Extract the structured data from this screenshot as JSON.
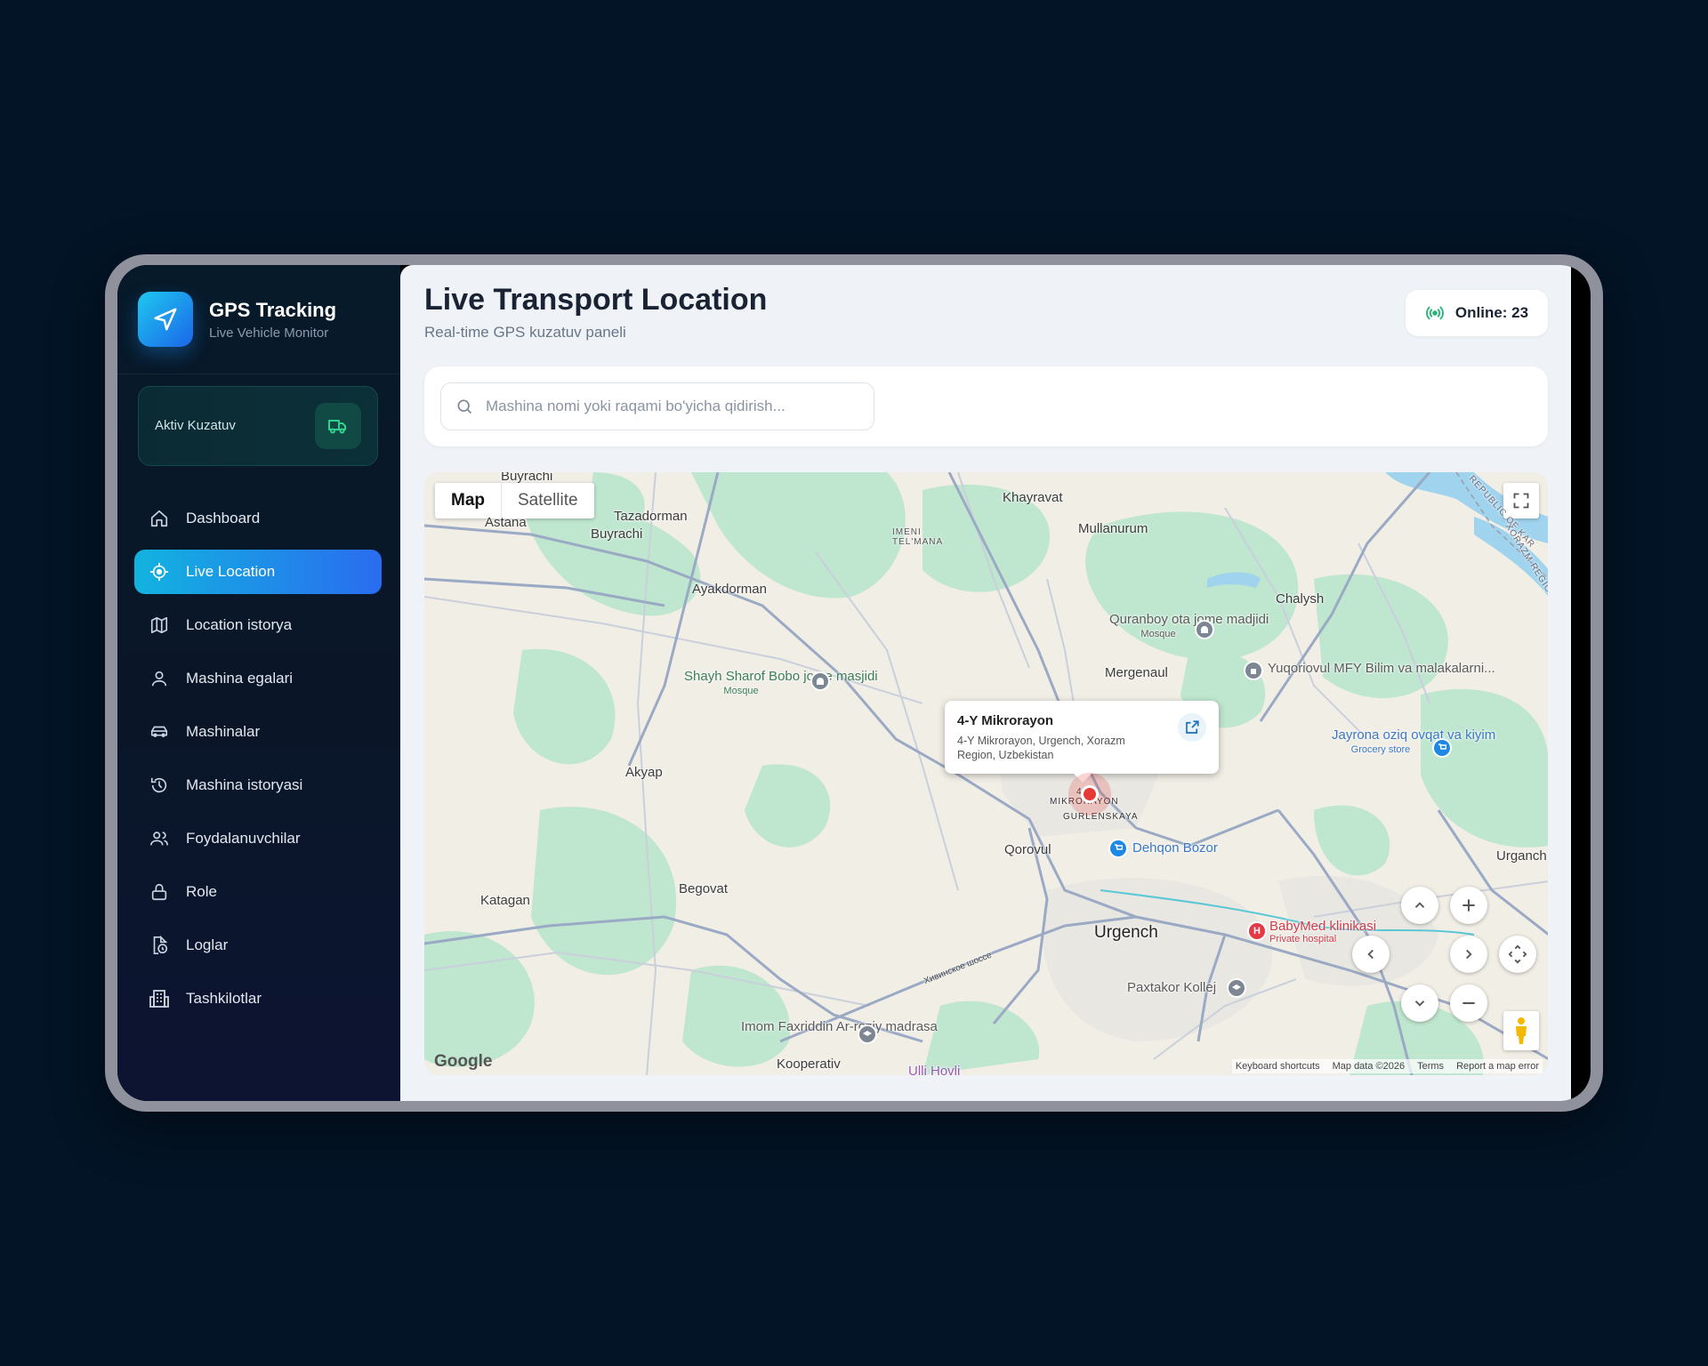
{
  "brand": {
    "title": "GPS Tracking",
    "subtitle": "Live Vehicle Monitor"
  },
  "aktiv": {
    "label": "Aktiv Kuzatuv",
    "icon": "truck-icon"
  },
  "nav": [
    {
      "label": "Dashboard",
      "icon": "home-icon"
    },
    {
      "label": "Live Location",
      "icon": "crosshair-icon",
      "active": true
    },
    {
      "label": "Location istorya",
      "icon": "map-icon"
    },
    {
      "label": "Mashina egalari",
      "icon": "user-icon"
    },
    {
      "label": "Mashinalar",
      "icon": "car-icon"
    },
    {
      "label": "Mashina istoryasi",
      "icon": "history-icon"
    },
    {
      "label": "Foydalanuvchilar",
      "icon": "users-icon"
    },
    {
      "label": "Role",
      "icon": "lock-icon"
    },
    {
      "label": "Loglar",
      "icon": "file-clock-icon"
    },
    {
      "label": "Tashkilotlar",
      "icon": "building-icon"
    }
  ],
  "header": {
    "title": "Live Transport Location",
    "subtitle": "Real-time GPS kuzatuv paneli"
  },
  "online": {
    "label": "Online: 23",
    "color": "#22b573"
  },
  "search": {
    "placeholder": "Mashina nomi yoki raqami bo'yicha qidirish...",
    "value": ""
  },
  "map": {
    "type_buttons": {
      "map": "Map",
      "satellite": "Satellite",
      "selected": "Map"
    },
    "places": {
      "buyrachi_top": "Buyrachi",
      "astana": "Astana",
      "tazadorman": "Tazadorman",
      "buyrachi": "Buyrachi",
      "imeni": "IMENI",
      "telmana": "TEL'MANA",
      "khayravat": "Khayravat",
      "mullanurum": "Mullanurum",
      "ayakdorman": "Ayakdorman",
      "chalysh": "Chalysh",
      "mergenaul": "Mergenaul",
      "akyap": "Akyap",
      "qorovul": "Qorovul",
      "katagan": "Katagan",
      "begovat": "Begovat",
      "urgench": "Urgench",
      "urganch": "Urganch",
      "kooperativ": "Kooperativ",
      "republic": "REPUBLIC OF KAR",
      "xorazm": "XORAZM REGIO",
      "mikro4": "4-Y",
      "mikrorayon": "MIKRORAYON",
      "gurlenskaya": "GURLENSKAYA",
      "road": "Хивинское шоссе"
    },
    "pois": {
      "quranboy": {
        "name": "Quranboy ota jome madjidi",
        "tag": "Mosque"
      },
      "shayh": {
        "name": "Shayh Sharof Bobo jome masjidi",
        "tag": "Mosque"
      },
      "yuqoriovul": {
        "name": "Yuqoriovul MFY Bilim va malakalarni..."
      },
      "jayrona": {
        "name": "Jayrona oziq ovqat va kiyim",
        "tag": "Grocery store"
      },
      "dehqon": {
        "name": "Dehqon Bozor"
      },
      "babymed": {
        "name": "BabyMed klinikasi",
        "tag": "Private hospital"
      },
      "paxtakor": {
        "name": "Paxtakor Kollej"
      },
      "imom": {
        "name": "Imom Faxriddin Ar-roziy madrasa"
      },
      "ulli": {
        "name": "Ulli Hovli"
      }
    },
    "info_window": {
      "title": "4-Y Mikrorayon",
      "address": "4-Y Mikrorayon, Urgench, Xorazm Region, Uzbekistan"
    },
    "attribution": {
      "logo": "Google",
      "shortcuts": "Keyboard shortcuts",
      "data": "Map data ©2026",
      "terms": "Terms",
      "report": "Report a map error"
    }
  }
}
